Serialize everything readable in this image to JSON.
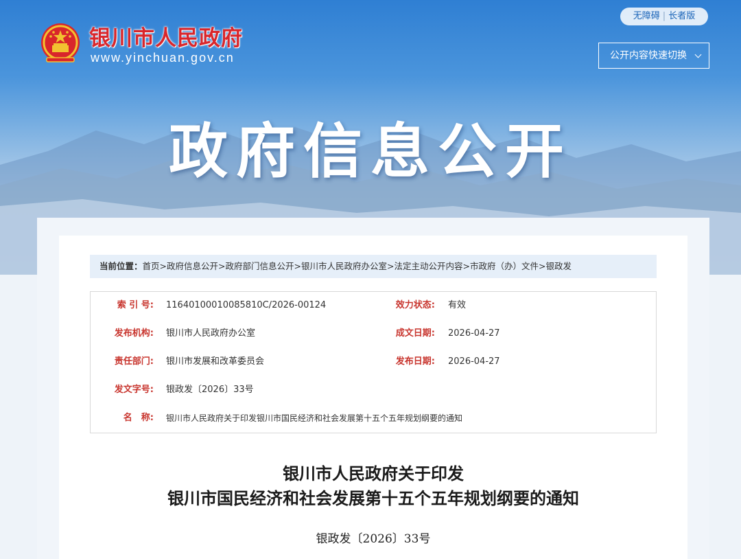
{
  "header": {
    "site_name": "银川市人民政府",
    "site_url": "www.yinchuan.gov.cn",
    "access_links": [
      "无障碍",
      "长者版"
    ],
    "quick_switch_label": "公开内容快速切换",
    "banner_title": "政府信息公开"
  },
  "breadcrumb": {
    "label": "当前位置：",
    "items": [
      "首页",
      "政府信息公开",
      "政府部门信息公开",
      "银川市人民政府办公室",
      "法定主动公开内容",
      "市政府（办）文件",
      "银政发"
    ],
    "separator": ">"
  },
  "metadata": {
    "index_no": {
      "label": "索 引 号:",
      "value": "11640100010085810C/2026-00124"
    },
    "validity": {
      "label": "效力状态:",
      "value": "有效"
    },
    "issuer": {
      "label": "发布机构:",
      "value": "银川市人民政府办公室"
    },
    "created_date": {
      "label": "成文日期:",
      "value": "2026-04-27"
    },
    "department": {
      "label": "责任部门:",
      "value": "银川市发展和改革委员会"
    },
    "publish_date": {
      "label": "发布日期:",
      "value": "2026-04-27"
    },
    "doc_no": {
      "label": "发文字号:",
      "value": "银政发〔2026〕33号"
    },
    "name": {
      "label": "名　称:",
      "value": "银川市人民政府关于印发银川市国民经济和社会发展第十五个五年规划纲要的通知"
    }
  },
  "document": {
    "title_line1": "银川市人民政府关于印发",
    "title_line2": "银川市国民经济和社会发展第十五个五年规划纲要的通知",
    "number": "银政发〔2026〕33号"
  },
  "colors": {
    "brand_red": "#d9262b",
    "label_red": "#c8352e",
    "link_blue": "#1a64b8",
    "banner_blue": "#2f7fd3"
  }
}
